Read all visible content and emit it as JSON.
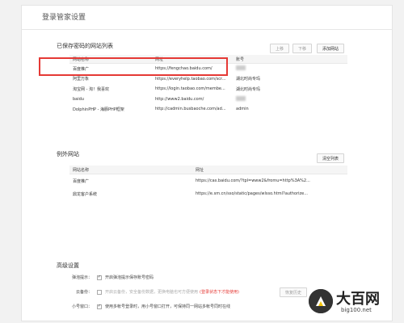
{
  "header": {
    "title": "登录管家设置"
  },
  "saved": {
    "title": "已保存密码的网站列表",
    "buttons": {
      "up": "上移",
      "down": "下移",
      "add": "添加网站"
    },
    "columns": [
      "网站名称",
      "网址",
      "账号"
    ],
    "rows": [
      {
        "name": "百度推广",
        "url": "https://fengchao.baidu.com/",
        "account": ""
      },
      {
        "name": "阿里万象",
        "url": "https://everyhelp.taobao.com/scr...",
        "account": "湖北时尚专玛"
      },
      {
        "name": "淘宝网 - 淘！我喜欢",
        "url": "https://login.taobao.com/membe...",
        "account": "湖北时尚专玛"
      },
      {
        "name": "baidu",
        "url": "http://www2.baidu.com/",
        "account": ""
      },
      {
        "name": "DolphinPHP - 海豚PHP框架",
        "url": "http://cadmin.busbaoche.com/ad...",
        "account": "admin"
      }
    ]
  },
  "exceptions": {
    "title": "例外网站",
    "clear_button": "清空列表",
    "columns": [
      "网站名称",
      "网址"
    ],
    "rows": [
      {
        "name": "百度推广",
        "url": "https://cas.baidu.com/?tpl=www2&fromu=http%3A%2..."
      },
      {
        "name": "鼎龙客户系统",
        "url": "https://e.sm.cn/sso/static/pages/wlsso.html?authorize..."
      }
    ]
  },
  "advanced": {
    "title": "高级设置",
    "rows": [
      {
        "label": "弹泡提示：",
        "checked": true,
        "text": "开启弹泡提示保存账号密码",
        "text_extra": "",
        "warn": ""
      },
      {
        "label": "云备份：",
        "checked": false,
        "text": "开启云备份，安全备份数据，更换电脑也可方便使用",
        "text_extra": "",
        "warn": "(登录状态下才能使用)"
      },
      {
        "label": "小号窗口：",
        "checked": true,
        "text": "使用多帐号登录时，用小号窗口打开，可保持同一网站多帐号同时在线",
        "text_extra": "",
        "warn": ""
      }
    ],
    "backup_button": "恢复历史"
  },
  "watermark": {
    "title": "大百网",
    "url": "big100.net"
  }
}
